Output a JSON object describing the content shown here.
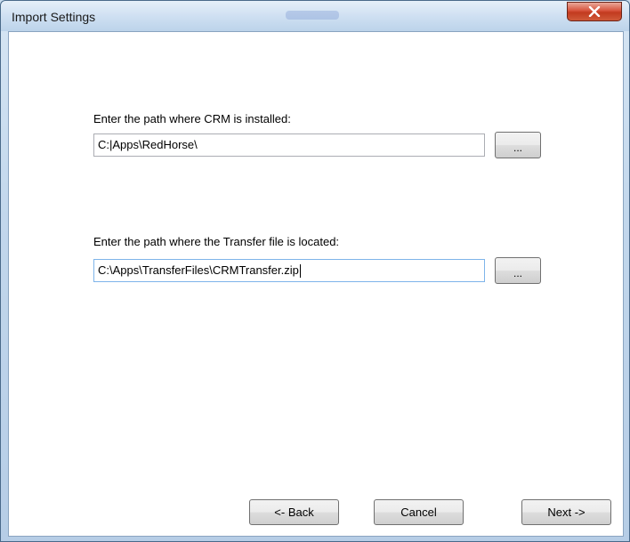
{
  "window": {
    "title": "Import Settings",
    "close_icon": "close-x-icon"
  },
  "crm_path": {
    "label": "Enter the path where CRM is installed:",
    "value": "C:|Apps\\RedHorse\\",
    "browse_label": "..."
  },
  "transfer_path": {
    "label": "Enter the path where the Transfer file is located:",
    "value": "C:\\Apps\\TransferFiles\\CRMTransfer.zip",
    "browse_label": "..."
  },
  "footer": {
    "back_label": "<- Back",
    "cancel_label": "Cancel",
    "next_label": "Next ->"
  },
  "colors": {
    "close_button": "#c23a1f",
    "focus_border": "#7eb4ea"
  }
}
